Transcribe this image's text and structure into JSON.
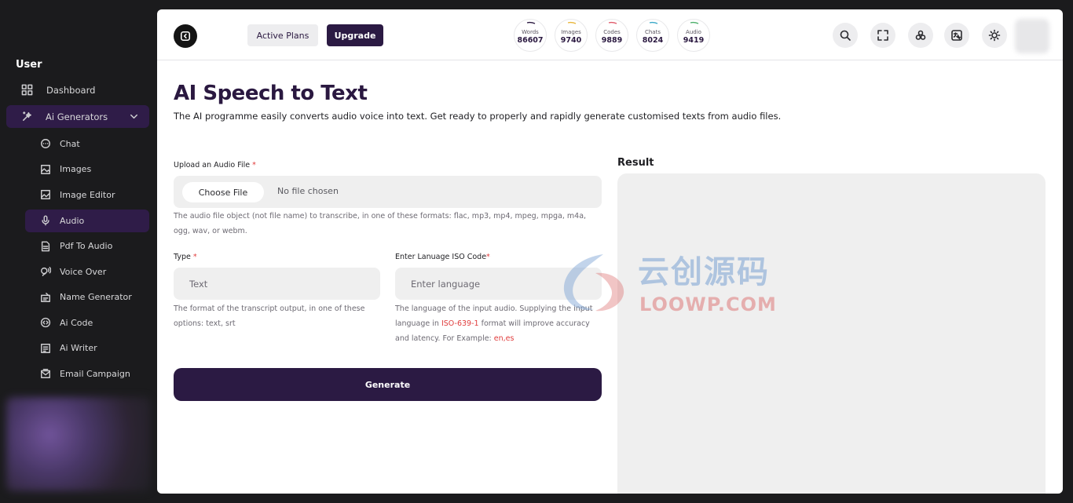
{
  "sidebar": {
    "heading": "User",
    "dashboard": "Dashboard",
    "group": "Ai Generators",
    "items": [
      {
        "label": "Chat",
        "icon": "chat-icon"
      },
      {
        "label": "Images",
        "icon": "image-icon"
      },
      {
        "label": "Image Editor",
        "icon": "image-editor-icon"
      },
      {
        "label": "Audio",
        "icon": "microphone-icon",
        "active": true
      },
      {
        "label": "Pdf To Audio",
        "icon": "pdf-icon"
      },
      {
        "label": "Voice Over",
        "icon": "voice-icon"
      },
      {
        "label": "Name Generator",
        "icon": "name-generator-icon"
      },
      {
        "label": "Ai Code",
        "icon": "code-icon"
      },
      {
        "label": "Ai Writer",
        "icon": "writer-icon"
      },
      {
        "label": "Email Campaign",
        "icon": "email-icon"
      }
    ]
  },
  "topbar": {
    "active_plans": "Active Plans",
    "upgrade": "Upgrade",
    "stats": [
      {
        "label": "Words",
        "value": "86607",
        "color": "#2a1840"
      },
      {
        "label": "Images",
        "value": "9740",
        "color": "#e8b63a"
      },
      {
        "label": "Codes",
        "value": "9889",
        "color": "#e05a6a"
      },
      {
        "label": "Chats",
        "value": "8024",
        "color": "#3aa8c8"
      },
      {
        "label": "Audio",
        "value": "9419",
        "color": "#4caf6a"
      }
    ]
  },
  "page": {
    "title": "AI Speech to Text",
    "description": "The AI programme easily converts audio voice into text. Get ready to properly and rapidly generate customised texts from audio files."
  },
  "form": {
    "upload_label": "Upload an Audio File",
    "choose_file": "Choose File",
    "no_file": "No file chosen",
    "upload_help": "The audio file object (not file name) to transcribe, in one of these formats: flac, mp3, mp4, mpeg, mpga, m4a, ogg, wav, or webm.",
    "type_label": "Type",
    "type_value": "Text",
    "type_help": "The format of the transcript output, in one of these options: text, srt",
    "lang_label": "Enter Lanuage ISO Code",
    "lang_placeholder": "Enter language",
    "lang_help_pre": "The language of the input audio. Supplying the input language in",
    "lang_help_link": "ISO-639-1",
    "lang_help_mid": "format will improve accuracy and latency. For Example:",
    "lang_help_example": "en,es",
    "required_mark": "*",
    "generate": "Generate"
  },
  "result": {
    "title": "Result"
  },
  "watermark": {
    "cn": "云创源码",
    "en": "LOOWP.COM"
  },
  "colors": {
    "accent": "#2b1a43",
    "required": "#e03c3c"
  }
}
